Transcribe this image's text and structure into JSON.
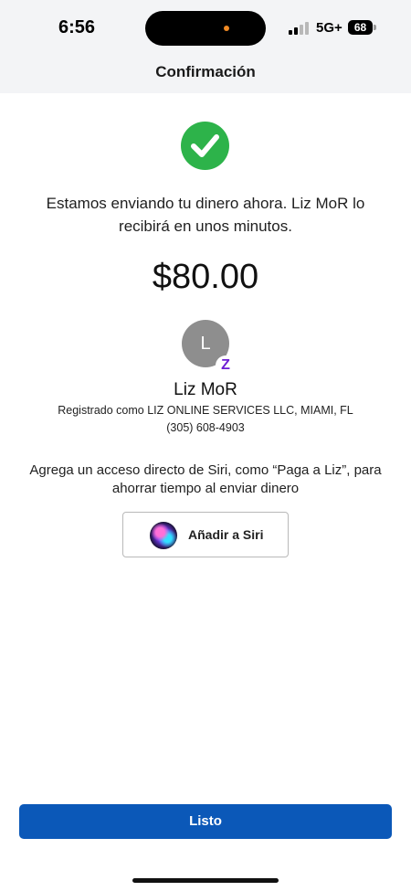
{
  "status_bar": {
    "time": "6:56",
    "network": "5G+",
    "battery": "68"
  },
  "header": {
    "title": "Confirmación"
  },
  "confirmation": {
    "check_icon": "checkmark-circle-icon",
    "message": "Estamos enviando tu dinero ahora. Liz MoR  lo recibirá en unos minutos.",
    "amount": "$80.00"
  },
  "recipient": {
    "avatar_letter": "L",
    "badge_icon": "zelle-icon",
    "badge_letter": "Z",
    "name": "Liz MoR",
    "registered_as": "Registrado como LIZ ONLINE SERVICES LLC, MIAMI, FL",
    "phone": "(305) 608-4903"
  },
  "siri": {
    "prompt": "Agrega un acceso directo de Siri, como “Paga a Liz”, para ahorrar tiempo al enviar dinero",
    "button_label": "Añadir a Siri",
    "icon": "siri-icon"
  },
  "footer": {
    "done_label": "Listo"
  },
  "colors": {
    "accent": "#0b58b8",
    "success": "#2db34a",
    "zelle": "#6d1ed4",
    "header_bg": "#f3f4f6"
  }
}
